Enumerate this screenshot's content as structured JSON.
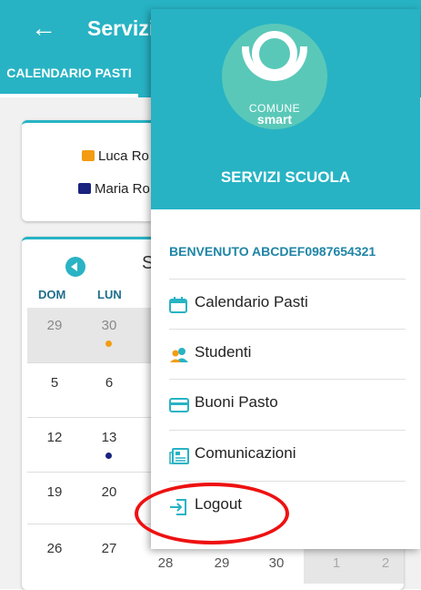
{
  "appbar": {
    "title": "Servizi",
    "tab": "CALENDARIO PASTI"
  },
  "students": [
    "Luca Ro",
    "Maria Ro"
  ],
  "calendar": {
    "month_fragment": "S",
    "weekdays": [
      "DOM",
      "LUN"
    ],
    "rows": [
      [
        "29",
        "30"
      ],
      [
        "5",
        "6"
      ],
      [
        "12",
        "13"
      ],
      [
        "19",
        "20"
      ],
      [
        "26",
        "27"
      ]
    ],
    "last_row_extra": [
      "28",
      "29",
      "30",
      "1",
      "2"
    ]
  },
  "drawer": {
    "logo_line1": "COMUNE",
    "logo_line2": "smart",
    "title": "SERVIZI SCUOLA",
    "welcome": "BENVENUTO ABCDEF0987654321",
    "items": [
      {
        "label": "Calendario Pasti",
        "icon": "calendar-icon"
      },
      {
        "label": "Studenti",
        "icon": "students-icon"
      },
      {
        "label": "Buoni Pasto",
        "icon": "card-icon"
      },
      {
        "label": "Comunicazioni",
        "icon": "news-icon"
      },
      {
        "label": "Logout",
        "icon": "logout-icon"
      }
    ]
  },
  "colors": {
    "primary": "#27b3c4",
    "accent_red": "#e11111",
    "orange": "#f39c12",
    "navy": "#1a237e"
  }
}
